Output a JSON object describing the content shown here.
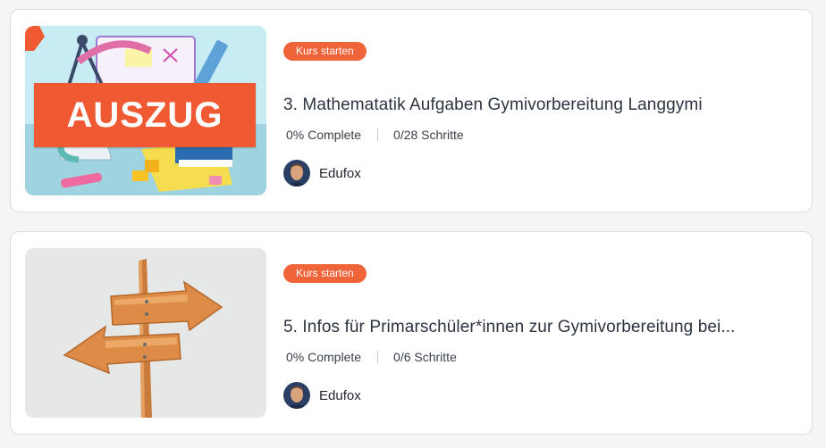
{
  "courses": [
    {
      "badge": "Kurs starten",
      "title": "3. Mathematatik Aufgaben Gymivorbereitung Langgymi",
      "progress": "0% Complete",
      "steps": "0/28 Schritte",
      "author": "Edufox",
      "thumbnail_overlay": "AUSZUG",
      "thumbnail_icon": "math-supplies-illustration"
    },
    {
      "badge": "Kurs starten",
      "title": "5. Infos für Primarschüler*innen zur Gymivorbereitung bei...",
      "progress": "0% Complete",
      "steps": "0/6 Schritte",
      "author": "Edufox",
      "thumbnail_icon": "wooden-signpost-illustration"
    }
  ],
  "colors": {
    "badge": "#f0643a",
    "auszug": "#f05a32"
  }
}
